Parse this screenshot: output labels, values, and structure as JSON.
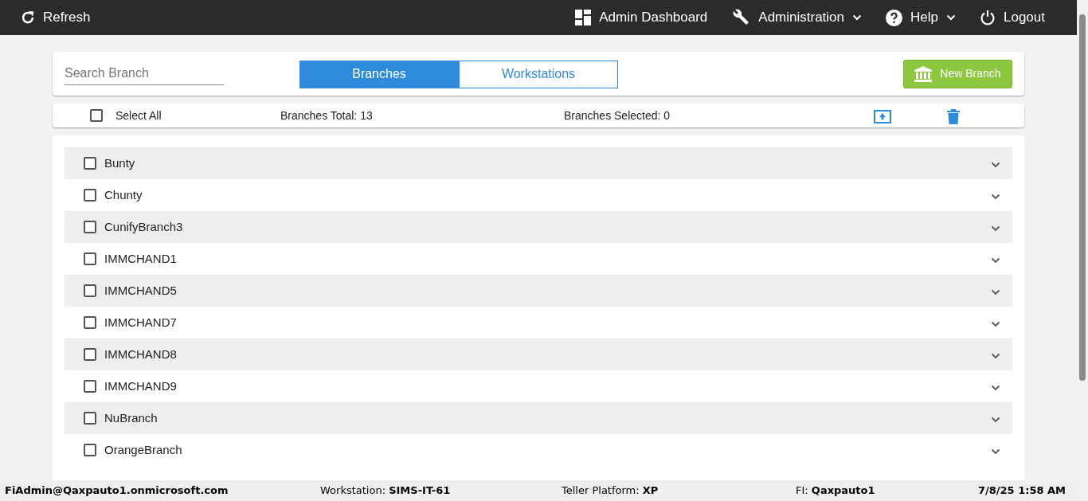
{
  "nav": {
    "left": {
      "label": "Refresh"
    },
    "right": [
      {
        "label": "Admin Dashboard",
        "dropdown": false
      },
      {
        "label": "Administration",
        "dropdown": true
      },
      {
        "label": "Help",
        "dropdown": true
      },
      {
        "label": "Logout",
        "dropdown": false
      }
    ]
  },
  "search": {
    "placeholder": "Search Branch"
  },
  "tabs": [
    {
      "label": "Branches",
      "selected": true
    },
    {
      "label": "Workstations",
      "selected": false
    }
  ],
  "new_button": "New Branch",
  "summary": {
    "select_all": {
      "label": "Select All",
      "checked": false
    },
    "total": "Branches Total: 13",
    "selected_count": "Branches Selected: 0"
  },
  "branches": [
    {
      "name": "Bunty",
      "checked": false
    },
    {
      "name": "Chunty",
      "checked": false
    },
    {
      "name": "CunifyBranch3",
      "checked": false
    },
    {
      "name": "IMMCHAND1",
      "checked": false
    },
    {
      "name": "IMMCHAND5",
      "checked": false
    },
    {
      "name": "IMMCHAND7",
      "checked": false
    },
    {
      "name": "IMMCHAND8",
      "checked": false
    },
    {
      "name": "IMMCHAND9",
      "checked": false
    },
    {
      "name": "NuBranch",
      "checked": false
    },
    {
      "name": "OrangeBranch",
      "checked": false
    }
  ],
  "status_bar": [
    {
      "value": "FiAdmin@Qaxpauto1.onmicrosoft.com"
    },
    {
      "label": "Workstation: ",
      "value": "SIMS-IT-61"
    },
    {
      "label": "Teller Platform: ",
      "value": "XP"
    },
    {
      "label": "FI: ",
      "value": "Qaxpauto1"
    },
    {
      "value": "7/8/25 1:58 AM"
    }
  ]
}
